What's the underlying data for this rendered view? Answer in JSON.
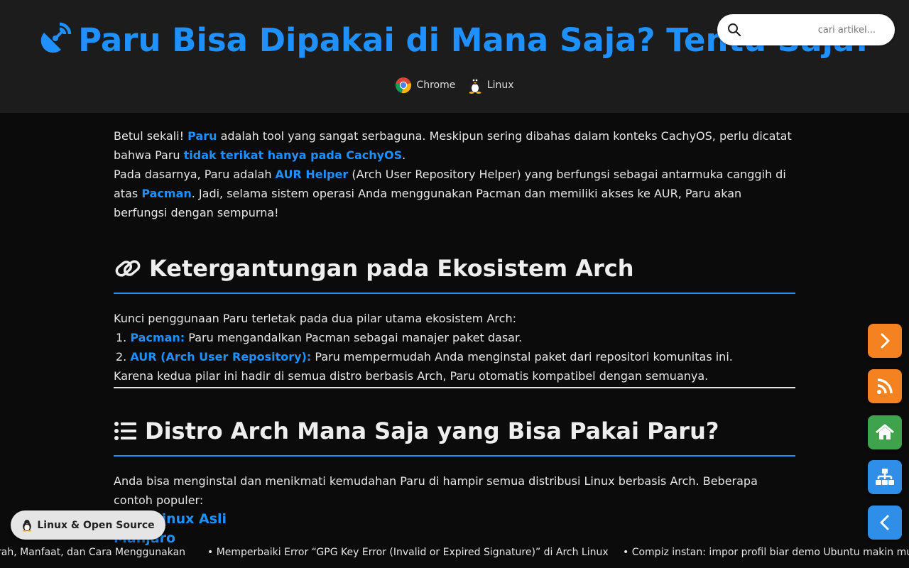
{
  "header": {
    "title": "Paru Bisa Dipakai di Mana Saja? Tentu Saja!",
    "tags": [
      {
        "label": "Chrome",
        "icon": "chrome-icon"
      },
      {
        "label": "Linux",
        "icon": "tux-icon"
      }
    ]
  },
  "search": {
    "placeholder": "cari artikel...",
    "icon": "search-icon"
  },
  "intro": {
    "p1_a": "Betul sekali! ",
    "p1_link1": "Paru",
    "p1_b": " adalah tool yang sangat serbaguna. Meskipun sering dibahas dalam konteks CachyOS, perlu dicatat bahwa Paru ",
    "p1_link2": "tidak terikat hanya pada CachyOS",
    "p1_c": ".",
    "p2_a": "Pada dasarnya, Paru adalah ",
    "p2_link1": "AUR Helper",
    "p2_b": " (Arch User Repository Helper) yang berfungsi sebagai antarmuka canggih di atas ",
    "p2_link2": "Pacman",
    "p2_c": ". Jadi, selama sistem operasi Anda menggunakan Pacman dan memiliki akses ke AUR, Paru akan berfungsi dengan sempurna!"
  },
  "section1": {
    "heading": "Ketergantungan pada Ekosistem Arch",
    "icon": "link-icon",
    "lead": "Kunci penggunaan Paru terletak pada dua pilar utama ekosistem Arch:",
    "items": [
      {
        "num": "1.",
        "term": "Pacman:",
        "text": " Paru mengandalkan Pacman sebagai manajer paket dasar."
      },
      {
        "num": "2.",
        "term": "AUR (Arch User Repository):",
        "text": " Paru mempermudah Anda menginstal paket dari repositori komunitas ini."
      }
    ],
    "closing": "Karena kedua pilar ini hadir di semua distro berbasis Arch, Paru otomatis kompatibel dengan semuanya."
  },
  "section2": {
    "heading": "Distro Arch Mana Saja yang Bisa Pakai Paru?",
    "icon": "list-icon",
    "lead": "Anda bisa menginstal dan menikmati kemudahan Paru di hampir semua distribusi Linux berbasis Arch. Beberapa contoh populer:",
    "distros": [
      "Arch Linux Asli",
      "Manjaro"
    ]
  },
  "side_buttons": [
    {
      "name": "next-button",
      "icon": "chevron-right-icon",
      "color": "#f58220"
    },
    {
      "name": "rss-button",
      "icon": "rss-icon",
      "color": "#f58220"
    },
    {
      "name": "home-button",
      "icon": "home-icon",
      "color": "#3fa34d"
    },
    {
      "name": "sitemap-button",
      "icon": "sitemap-icon",
      "color": "#2f8fe8"
    },
    {
      "name": "prev-button",
      "icon": "chevron-left-icon",
      "color": "#2f8fe8"
    }
  ],
  "category_pill": {
    "label": "Linux & Open Source",
    "icon": "tux-icon"
  },
  "ticker": {
    "items": [
      "rah, Manfaat, dan Cara Menggunakan",
      "• Memperbaiki Error “GPG Key Error (Invalid or Expired Signature)” di Arch Linux",
      "• Compiz instan: impor profil biar demo Ubuntu makin mud"
    ]
  },
  "colors": {
    "accent": "#1e90ff",
    "header_bg": "#1c1c1c",
    "page_bg": "#0b0b0b"
  }
}
